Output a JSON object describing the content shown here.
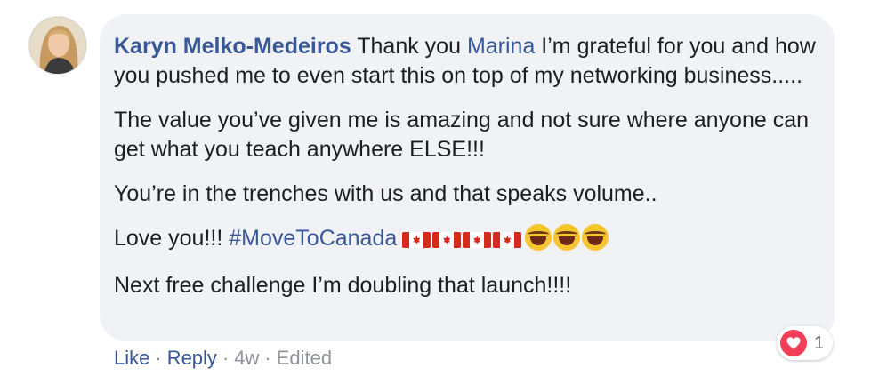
{
  "comment": {
    "author": "Karyn Melko-Medeiros",
    "line1_after_author": " Thank you ",
    "mention": "Marina",
    "line1_rest": " I’m grateful for you and how you pushed me to even start this on top of my networking business.....",
    "para2": "The value you’ve given me is amazing and not sure where anyone can get what you teach anywhere ELSE!!!",
    "para3": "You’re in the trenches with us and that speaks volume..",
    "para4_text": "Love you!!! ",
    "hashtag": "#MoveToCanada",
    "para5": "Next free challenge I’m doubling that launch!!!!"
  },
  "actions": {
    "like": "Like",
    "reply": "Reply",
    "time": "4w",
    "edited": "Edited",
    "dot": "·"
  },
  "reactions": {
    "count": "1",
    "type": "love-heart-icon"
  },
  "colors": {
    "bubble": "#f0f2f5",
    "link": "#385898",
    "meta": "#90949c",
    "heart": "#f33e58"
  }
}
